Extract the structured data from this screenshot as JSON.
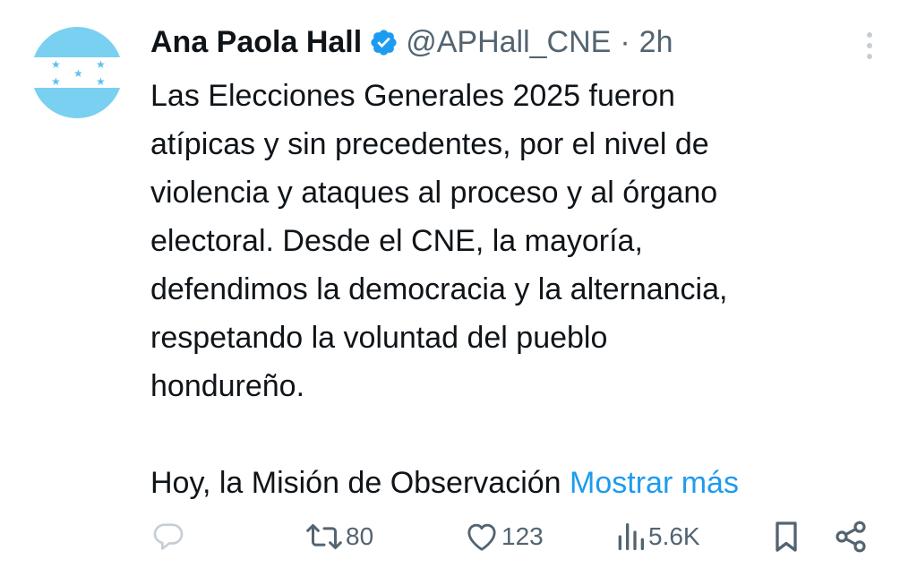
{
  "author": {
    "name": "Ana Paola Hall",
    "handle": "@APHall_CNE",
    "separator": "·",
    "time": "2h",
    "verified_icon": "verified-badge-icon"
  },
  "avatar": {
    "description_icon": "honduras-flag-avatar",
    "colors": {
      "stripe": "#7ad0f0",
      "field": "#ffffff",
      "stars": "#5cc2eb"
    }
  },
  "tweet": {
    "lines": [
      "Las Elecciones Generales 2025 fueron",
      "atípicas y sin precedentes, por el nivel de",
      "violencia y ataques al proceso y al órgano",
      "electoral. Desde el CNE, la mayoría,",
      "defendimos la democracia y la alternancia,",
      "respetando la voluntad del pueblo",
      "hondureño."
    ],
    "last_line": "Hoy, la Misión de Observación",
    "show_more": "Mostrar más"
  },
  "actions": {
    "reply": {
      "icon": "reply-icon",
      "count": ""
    },
    "repost": {
      "icon": "repost-icon",
      "count": "80"
    },
    "like": {
      "icon": "heart-icon",
      "count": "123"
    },
    "views": {
      "icon": "views-chart-icon",
      "count": "5.6K"
    },
    "bookmark": {
      "icon": "bookmark-icon"
    },
    "share": {
      "icon": "share-icon"
    }
  },
  "colors": {
    "text": "#0f1419",
    "secondary": "#536471",
    "accent": "#1d9bf0",
    "icon_gray": "#c7ced3"
  }
}
